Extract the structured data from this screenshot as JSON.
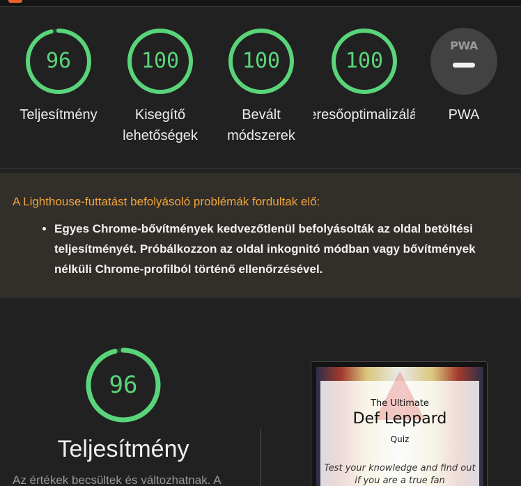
{
  "colors": {
    "pass": "#5ad47a",
    "warning_title": "#f0a53a",
    "background": "#212121"
  },
  "gauges": [
    {
      "score": "96",
      "label_line1": "Teljesítmény",
      "label_line2": "",
      "value": 96
    },
    {
      "score": "100",
      "label_line1": "Kisegítő",
      "label_line2": "lehetőségek",
      "value": 100
    },
    {
      "score": "100",
      "label_line1": "Bevált",
      "label_line2": "módszerek",
      "value": 100
    },
    {
      "score": "100",
      "label_line1": "Keresőoptimalizálás",
      "label_line2": "",
      "value": 100
    }
  ],
  "pwa": {
    "badge": "PWA",
    "label": "PWA"
  },
  "warning": {
    "title": "A Lighthouse-futtatást befolyásoló problémák fordultak elő:",
    "items": [
      "Egyes Chrome-bővítmények kedvezőtlenül befolyásolták az oldal betöltési teljesítményét. Próbálkozzon az oldal inkognitó módban vagy bővítmények nélküli Chrome-profilból történő ellenőrzésével."
    ]
  },
  "performance": {
    "score": "96",
    "value": 96,
    "title": "Teljesítmény",
    "note": "Az értékek becsültek és változhatnak. A"
  },
  "thumbnail": {
    "line1": "The Ultimate",
    "line2": "Def Leppard",
    "line3": "Quiz",
    "line4": "Test your knowledge and find out if you are a true fan"
  }
}
